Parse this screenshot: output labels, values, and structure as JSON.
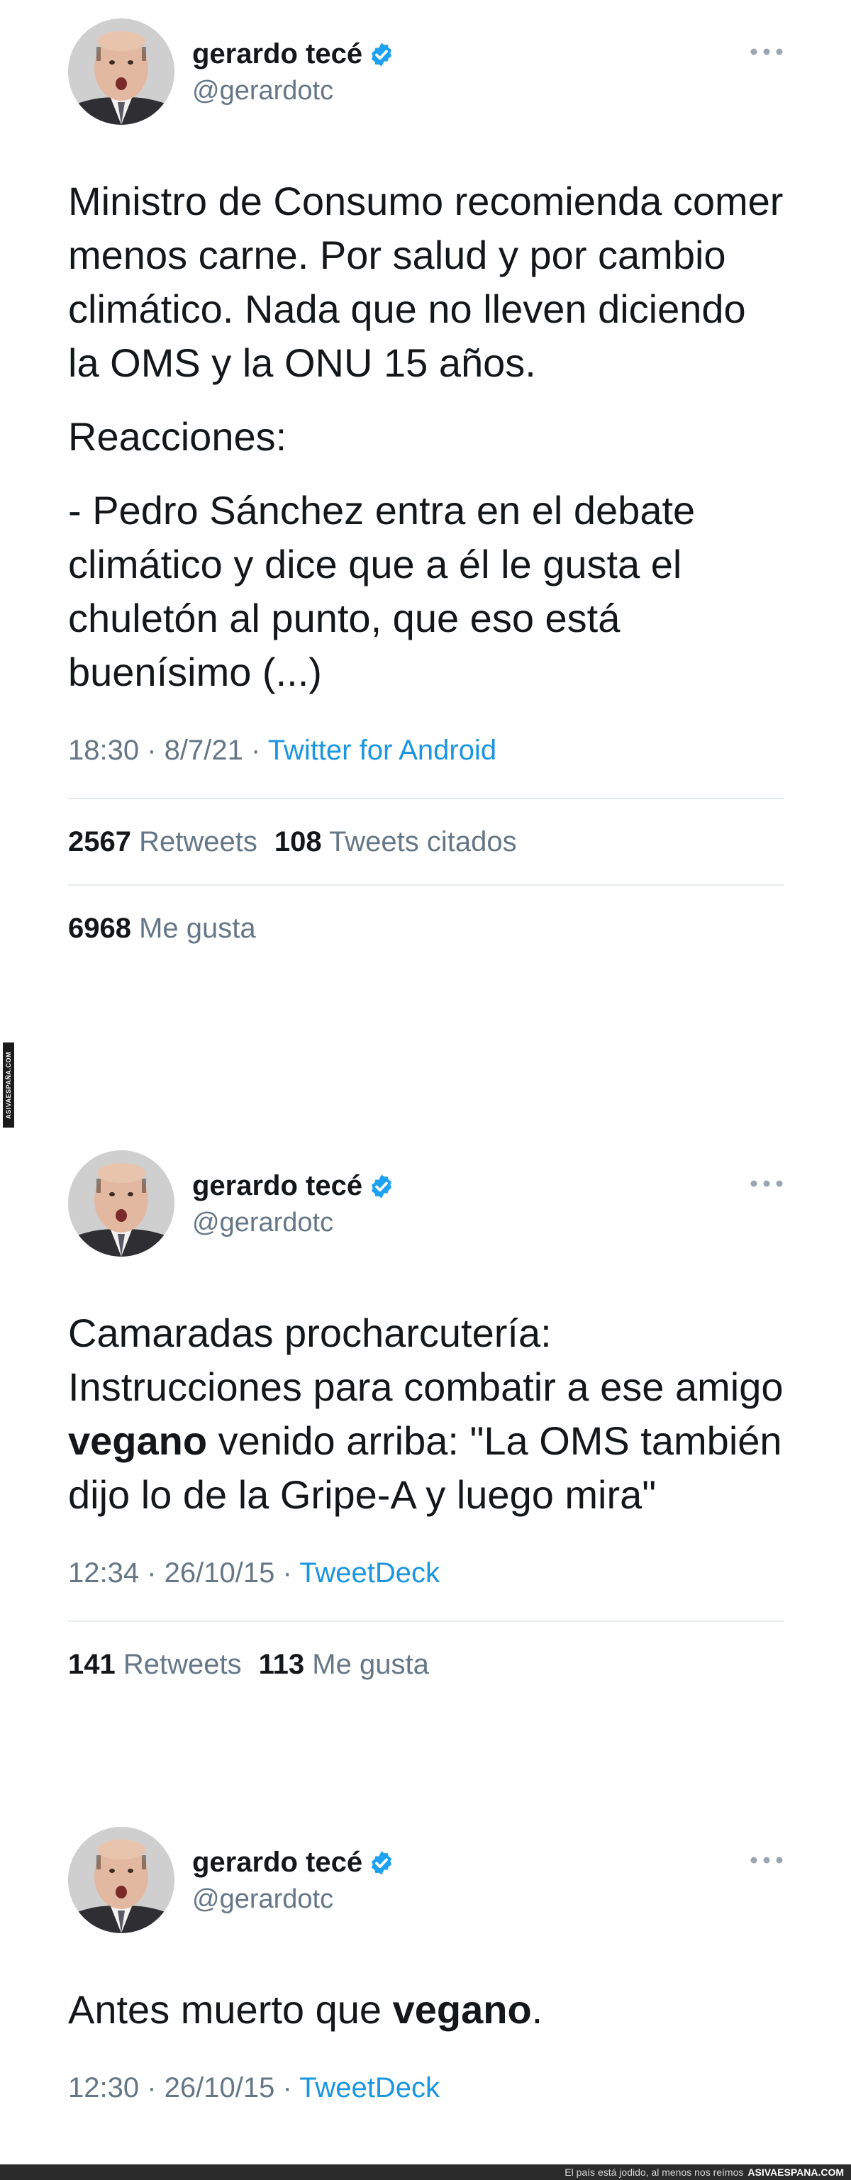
{
  "watermark": {
    "side_text": "ASIVAESPAÑA.COM"
  },
  "tweets": [
    {
      "display_name": "gerardo tecé",
      "handle": "@gerardotc",
      "paragraphs": [
        "Ministro de Consumo recomienda comer menos carne. Por salud y por cambio climático. Nada que no lleven diciendo la OMS y la ONU 15 años.",
        "Reacciones:",
        "- Pedro Sánchez entra en el debate climático y dice que a él le gusta el chuletón al punto, que eso está buenísimo (...)"
      ],
      "time": "18:30",
      "date": "8/7/21",
      "source": "Twitter for Android",
      "retweets": "2567",
      "retweets_label": "Retweets",
      "quotes": "108",
      "quotes_label": "Tweets citados",
      "likes": "6968",
      "likes_label": "Me gusta"
    },
    {
      "display_name": "gerardo tecé",
      "handle": "@gerardotc",
      "text_before": "Camaradas procharcutería: Instrucciones para combatir a ese amigo ",
      "text_bold": "vegano",
      "text_after": " venido arriba: \"La OMS también dijo lo de la Gripe-A y luego mira\"",
      "time": "12:34",
      "date": "26/10/15",
      "source": "TweetDeck",
      "retweets": "141",
      "retweets_label": "Retweets",
      "likes": "113",
      "likes_label": "Me gusta"
    },
    {
      "display_name": "gerardo tecé",
      "handle": "@gerardotc",
      "text_before": "Antes muerto que ",
      "text_bold": "vegano",
      "text_after": ".",
      "time": "12:30",
      "date": "26/10/15",
      "source": "TweetDeck"
    }
  ],
  "footer": {
    "tagline": "El país está jodido, al menos nos reímos",
    "brand": "ASIVAESPANA.COM"
  },
  "icons": {
    "verified": "verified-badge-icon",
    "more": "more-options-icon",
    "avatar": "avatar"
  },
  "colors": {
    "text": "#14171a",
    "secondary": "#657786",
    "link": "#1b95e0",
    "verified": "#1da1f2",
    "divider": "#e6ecf0"
  }
}
